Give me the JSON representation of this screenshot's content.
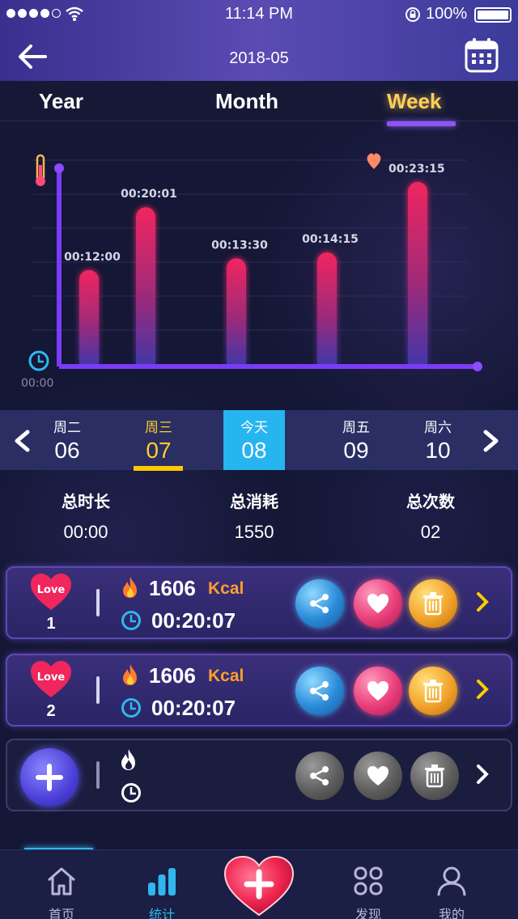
{
  "status_bar": {
    "time": "11:14 PM",
    "battery": "100%"
  },
  "header": {
    "title": "2018-05"
  },
  "range_tabs": {
    "year": "Year",
    "month": "Month",
    "week": "Week",
    "active": "week"
  },
  "chart_data": {
    "type": "bar",
    "categories": [
      "b1",
      "b2",
      "b3",
      "b4",
      "b5"
    ],
    "values_seconds": [
      720,
      1201,
      810,
      855,
      1395
    ],
    "labels": [
      "00:12:00",
      "00:20:01",
      "00:13:30",
      "00:14:15",
      "00:23:15"
    ],
    "y_min_label": "00:00",
    "colors": {
      "bar_top": "#e9265f",
      "bar_bottom": "#4a3aa8",
      "axis": "#7b3cf6"
    }
  },
  "date_strip": {
    "days": [
      {
        "weekday": "周二",
        "day": "06",
        "state": "normal"
      },
      {
        "weekday": "周三",
        "day": "07",
        "state": "selected"
      },
      {
        "weekday": "今天",
        "day": "08",
        "state": "today"
      },
      {
        "weekday": "周五",
        "day": "09",
        "state": "normal"
      },
      {
        "weekday": "周六",
        "day": "10",
        "state": "normal"
      }
    ]
  },
  "summary": {
    "total_duration_label": "总时长",
    "total_duration": "00:00",
    "total_burn_label": "总消耗",
    "total_burn": "1550",
    "total_count_label": "总次数",
    "total_count": "02"
  },
  "sessions": [
    {
      "badge": "Love",
      "index": "1",
      "kcal": "1606",
      "kcal_unit": "Kcal",
      "duration": "00:20:07"
    },
    {
      "badge": "Love",
      "index": "2",
      "kcal": "1606",
      "kcal_unit": "Kcal",
      "duration": "00:20:07"
    }
  ],
  "tabbar": {
    "home": "首页",
    "stats": "统计",
    "discover": "发现",
    "mine": "我的",
    "active": "stats"
  }
}
